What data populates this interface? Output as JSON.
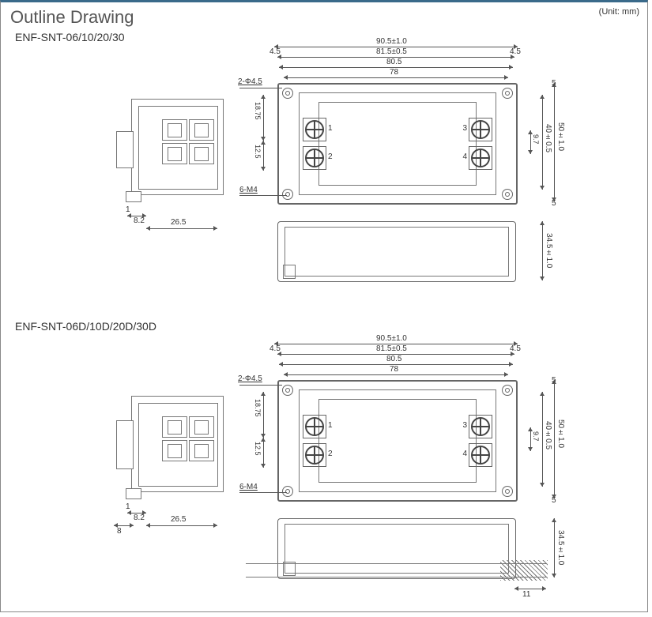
{
  "title": "Outline Drawing",
  "unit_label": "(Unit: mm)",
  "model_a": "ENF-SNT-06/10/20/30",
  "model_b": "ENF-SNT-06D/10D/20D/30D",
  "notes": {
    "hole_pair": "2-Φ4.5",
    "screws": "6-M4"
  },
  "dims": {
    "overall_w_tol": "90.5±1.0",
    "body_w_tol": "81.5±0.5",
    "flat_w": "80.5",
    "mount_pitch_w": "78",
    "end_w_left": "4.5",
    "end_w_right": "4.5",
    "overall_h_tol": "50±1.0",
    "body_h_tol": "40±0.5",
    "inner_h": "9.7",
    "end_h_top": "5",
    "end_h_bot": "5",
    "depth_tol": "34.5±1.0",
    "side_term_upper": "18.75",
    "side_term_lower": "12.5",
    "side_x1": "1",
    "side_x2": "8.2",
    "side_x3": "26.5",
    "side_x_extra_b": "8",
    "rail_end": "11"
  },
  "terminals": {
    "t1": "1",
    "t2": "2",
    "t3": "3",
    "t4": "4"
  }
}
